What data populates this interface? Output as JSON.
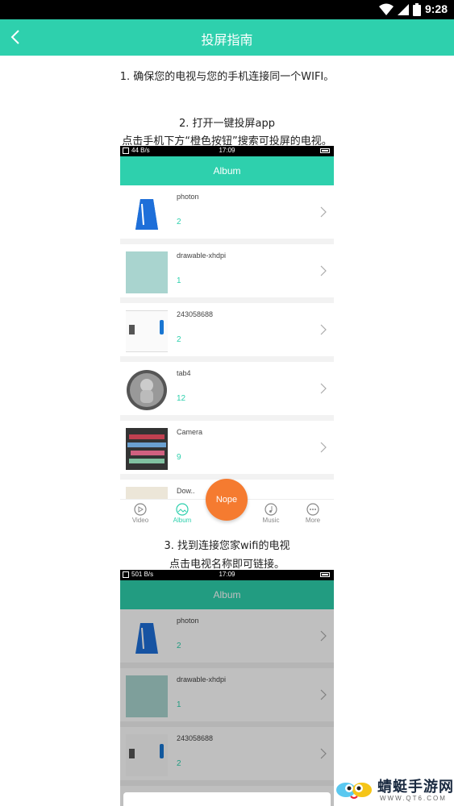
{
  "status_bar": {
    "time": "9:28"
  },
  "app_bar": {
    "title": "投屏指南"
  },
  "steps": {
    "step1": "1. 确保您的电视与您的手机连接同一个WIFI。",
    "step2_title": "2. 打开一键投屏app",
    "step2_desc": "点击手机下方“橙色按钮”搜索可投屏的电视。",
    "step3_title": "3. 找到连接您家wifi的电视",
    "step3_desc": "点击电视名称即可链接。"
  },
  "screenshot1": {
    "status": {
      "net": "44 B/s",
      "time": "17:09"
    },
    "header": "Album",
    "albums": [
      {
        "name": "photon",
        "count": "2"
      },
      {
        "name": "drawable-xhdpi",
        "count": "1"
      },
      {
        "name": "243058688",
        "count": "2"
      },
      {
        "name": "tab4",
        "count": "12"
      },
      {
        "name": "Camera",
        "count": "9"
      },
      {
        "name": "Dow..",
        "count": ""
      }
    ],
    "tabs": [
      {
        "label": "Video",
        "icon": "play-circle-icon"
      },
      {
        "label": "Album",
        "icon": "image-icon"
      },
      {
        "label": "Music",
        "icon": "music-note-icon"
      },
      {
        "label": "More",
        "icon": "more-dots-icon"
      }
    ],
    "fab_label": "Nope",
    "colors": {
      "accent": "#2ed0ad",
      "fab": "#f57b30"
    }
  },
  "screenshot2": {
    "status": {
      "net": "501 B/s",
      "time": "17:09"
    },
    "header": "Album",
    "albums": [
      {
        "name": "photon",
        "count": "2"
      },
      {
        "name": "drawable-xhdpi",
        "count": "1"
      },
      {
        "name": "243058688",
        "count": "2"
      }
    ]
  },
  "watermark": {
    "text": "蜻蜓手游网",
    "url": "WWW.QT6.COM"
  }
}
